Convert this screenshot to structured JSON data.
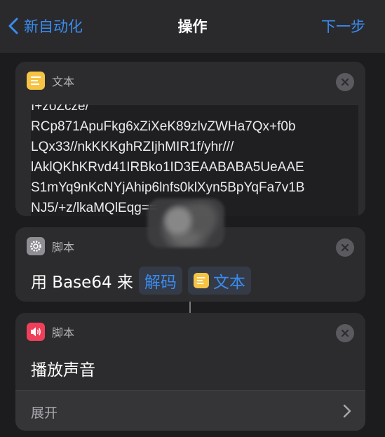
{
  "nav": {
    "back_label": "新自动化",
    "title": "操作",
    "next_label": "下一步"
  },
  "text_action": {
    "header": "文本",
    "lines": [
      "I+zoZcze/",
      "RCp871ApuFkg6xZiXeK89zlvZWHa7Qx+f0b",
      "LQx33//nkKKKghRZIjhMIR1f/yhr///",
      "lAklQKhKRvd41IRBko1ID3EAABABA5UeAAE",
      "S1mYq9nKcNYjAhip6lnfs0klXyn5BpYqFa7v1B",
      "NJ5/+z/lkaMQlEqg=="
    ]
  },
  "script_action": {
    "header": "脚本",
    "prefix": "用 Base64 来",
    "operation": "解码",
    "variable": "文本"
  },
  "sound_action": {
    "header": "脚本",
    "title": "播放声音",
    "expand_label": "展开"
  },
  "colors": {
    "accent": "#3a8cf0",
    "background": "#1c1c1e",
    "card": "#2c2c2e"
  }
}
